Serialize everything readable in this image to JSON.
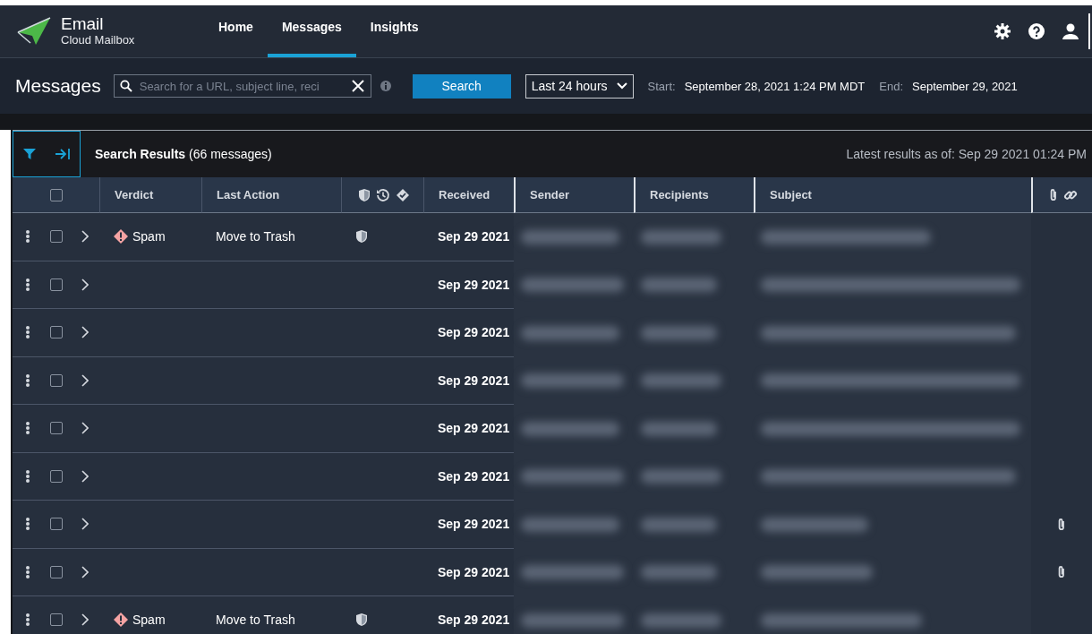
{
  "header": {
    "app_title": "Email",
    "app_subtitle": "Cloud Mailbox",
    "nav": [
      {
        "label": "Home",
        "selected": false
      },
      {
        "label": "Messages",
        "selected": true
      },
      {
        "label": "Insights",
        "selected": false
      }
    ]
  },
  "toolbar": {
    "title": "Messages",
    "search": {
      "placeholder": "Search for a URL, subject line, reci"
    },
    "search_button": "Search",
    "time_range": "Last 24 hours",
    "start_label": "Start:",
    "start": "September 28, 2021 1:24 PM MDT",
    "end_label": "End:",
    "end": "September 29, 2021"
  },
  "results": {
    "filter_panel_on": true,
    "select_all_checked": false,
    "title": "Search Results",
    "count": "(66 messages)",
    "latest": "Latest results as of: Sep 29 2021 01:24 PM"
  },
  "table": {
    "columns": [
      "Verdict",
      "Last Action",
      "Received",
      "Sender",
      "Recipients",
      "Subject"
    ],
    "rows": [
      {
        "verdict": "Spam",
        "last_action": "Move to Trash",
        "shielded": true,
        "received": "Sep 29 2021",
        "attachment": false,
        "checked": false
      },
      {
        "received": "Sep 29 2021",
        "shielded": false,
        "attachment": false,
        "checked": false
      },
      {
        "received": "Sep 29 2021",
        "shielded": false,
        "attachment": false,
        "checked": false
      },
      {
        "received": "Sep 29 2021",
        "shielded": false,
        "attachment": false,
        "checked": false
      },
      {
        "received": "Sep 29 2021",
        "shielded": false,
        "attachment": false,
        "checked": false
      },
      {
        "received": "Sep 29 2021",
        "shielded": false,
        "attachment": false,
        "checked": false
      },
      {
        "received": "Sep 29 2021",
        "shielded": false,
        "attachment": true,
        "checked": false
      },
      {
        "received": "Sep 29 2021",
        "shielded": false,
        "attachment": true,
        "checked": false
      },
      {
        "verdict": "Spam",
        "last_action": "Move to Trash",
        "shielded": true,
        "received": "Sep 29 2021",
        "attachment": false,
        "checked": false
      }
    ]
  }
}
